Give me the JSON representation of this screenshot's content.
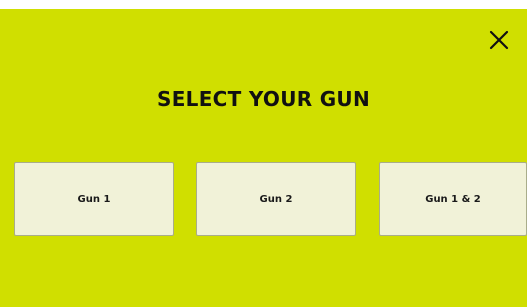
{
  "dialog": {
    "title": "SELECT YOUR GUN",
    "close_icon": "close-icon",
    "options": [
      {
        "label": "Gun 1"
      },
      {
        "label": "Gun 2"
      },
      {
        "label": "Gun 1 & 2"
      }
    ]
  },
  "colors": {
    "background": "#d0df00",
    "button_fill": "#f1f2d8",
    "button_border": "#a9ad8a",
    "text": "#111111"
  }
}
